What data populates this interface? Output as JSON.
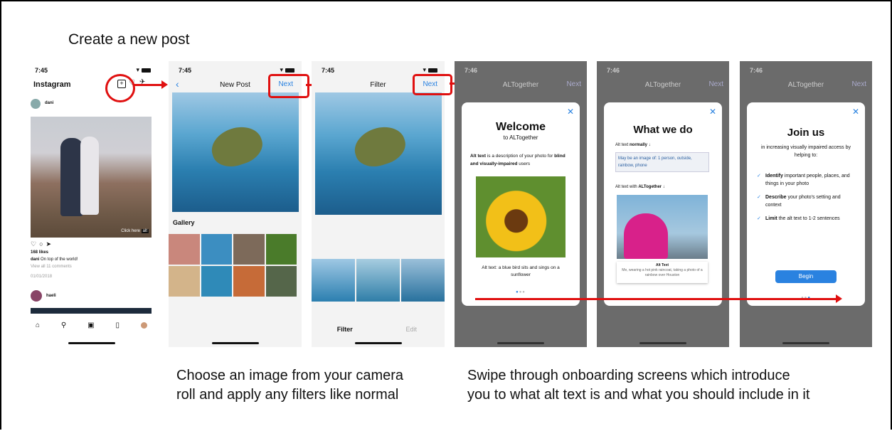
{
  "page": {
    "title": "Create a new post",
    "caption_left_line1": "Choose an image from your camera",
    "caption_left_line2": "roll and apply any filters like normal",
    "caption_right_line1": "Swipe through onboarding screens which introduce",
    "caption_right_line2": "you to what alt text is and what you should include in it"
  },
  "screen1": {
    "time": "7:45",
    "app": "Instagram",
    "user": "dani",
    "click_here": "Click here",
    "alt_badge": "alt",
    "likes": "168 likes",
    "caption_user": "dani",
    "caption_text": "On top of the world!",
    "comments": "View all 11 comments",
    "date": "01/01/2018",
    "user2": "haeli"
  },
  "screen2": {
    "time": "7:45",
    "nav_title": "New Post",
    "next": "Next",
    "gallery": "Gallery"
  },
  "screen3": {
    "time": "7:45",
    "nav_title": "Filter",
    "next": "Next",
    "tab_filter": "Filter",
    "tab_edit": "Edit"
  },
  "onboard1": {
    "time": "7:46",
    "nav_title": "ALTogether",
    "next": "Next",
    "heading": "Welcome",
    "sub": "to ALTogether",
    "body_bold1": "Alt text",
    "body1": " is a description of your photo for ",
    "body_bold2": "blind and visually-impaired",
    "body2": " users",
    "image_alt": "Alt text: a blue bird sits and sings on a sunflower"
  },
  "onboard2": {
    "time": "7:46",
    "nav_title": "ALTogether",
    "next": "Next",
    "heading": "What we do",
    "label1_pre": "Alt text ",
    "label1_bold": "normally",
    "label1_post": " ↓",
    "normal_alt": "May be an image of: 1 person, outside, rainbow, phone",
    "label2_pre": "Alt text with ",
    "label2_bold": "ALTogether",
    "label2_post": " ↓",
    "card_title": "Alt Text",
    "card_text": "Me, wearing a hot pink raincoat, taking a photo of a rainbow over Houston"
  },
  "onboard3": {
    "time": "7:46",
    "nav_title": "ALTogether",
    "next": "Next",
    "heading": "Join us",
    "intro": "in increasing visually impaired access by helping to:",
    "b1_bold": "Identify",
    "b1": " important people, places, and things in your photo",
    "b2_bold": "Describe",
    "b2": " your photo's setting and context",
    "b3_bold": "Limit",
    "b3": " the alt text to 1-2 sentences",
    "button": "Begin"
  },
  "colors": {
    "accent": "#2a82e0",
    "annotation": "#e01010",
    "overlay": "#6b6b6b"
  },
  "icons": [
    "add-post-icon",
    "heart-icon",
    "send-icon",
    "comment-icon",
    "home-icon",
    "search-icon",
    "reels-icon",
    "bookmark-icon",
    "back-chevron-icon",
    "close-icon",
    "check-icon"
  ]
}
